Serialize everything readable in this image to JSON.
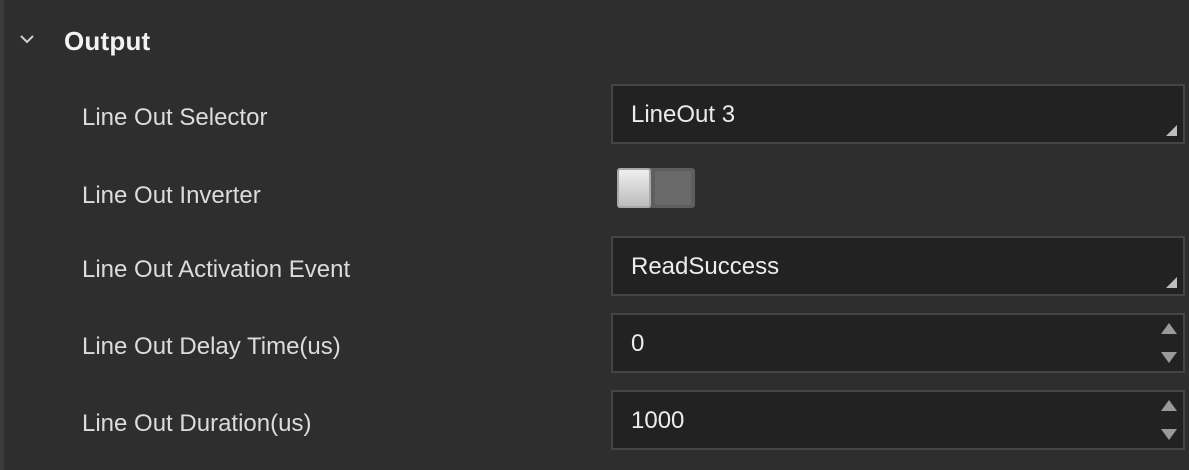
{
  "group": {
    "title": "Output",
    "expanded_icon": "chevron-down-icon"
  },
  "rows": [
    {
      "label": "Line Out Selector",
      "control": "combo",
      "value": "LineOut 3"
    },
    {
      "label": "Line Out Inverter",
      "control": "toggle",
      "value": "off"
    },
    {
      "label": "Line Out Activation Event",
      "control": "combo",
      "value": "ReadSuccess"
    },
    {
      "label": "Line Out Delay Time(us)",
      "control": "spinbox",
      "value": "0"
    },
    {
      "label": "Line Out Duration(us)",
      "control": "spinbox",
      "value": "1000"
    }
  ],
  "colors": {
    "background": "#2e2e2e",
    "field_background": "#222222",
    "field_border": "#454545",
    "text": "#dcdcdc"
  }
}
